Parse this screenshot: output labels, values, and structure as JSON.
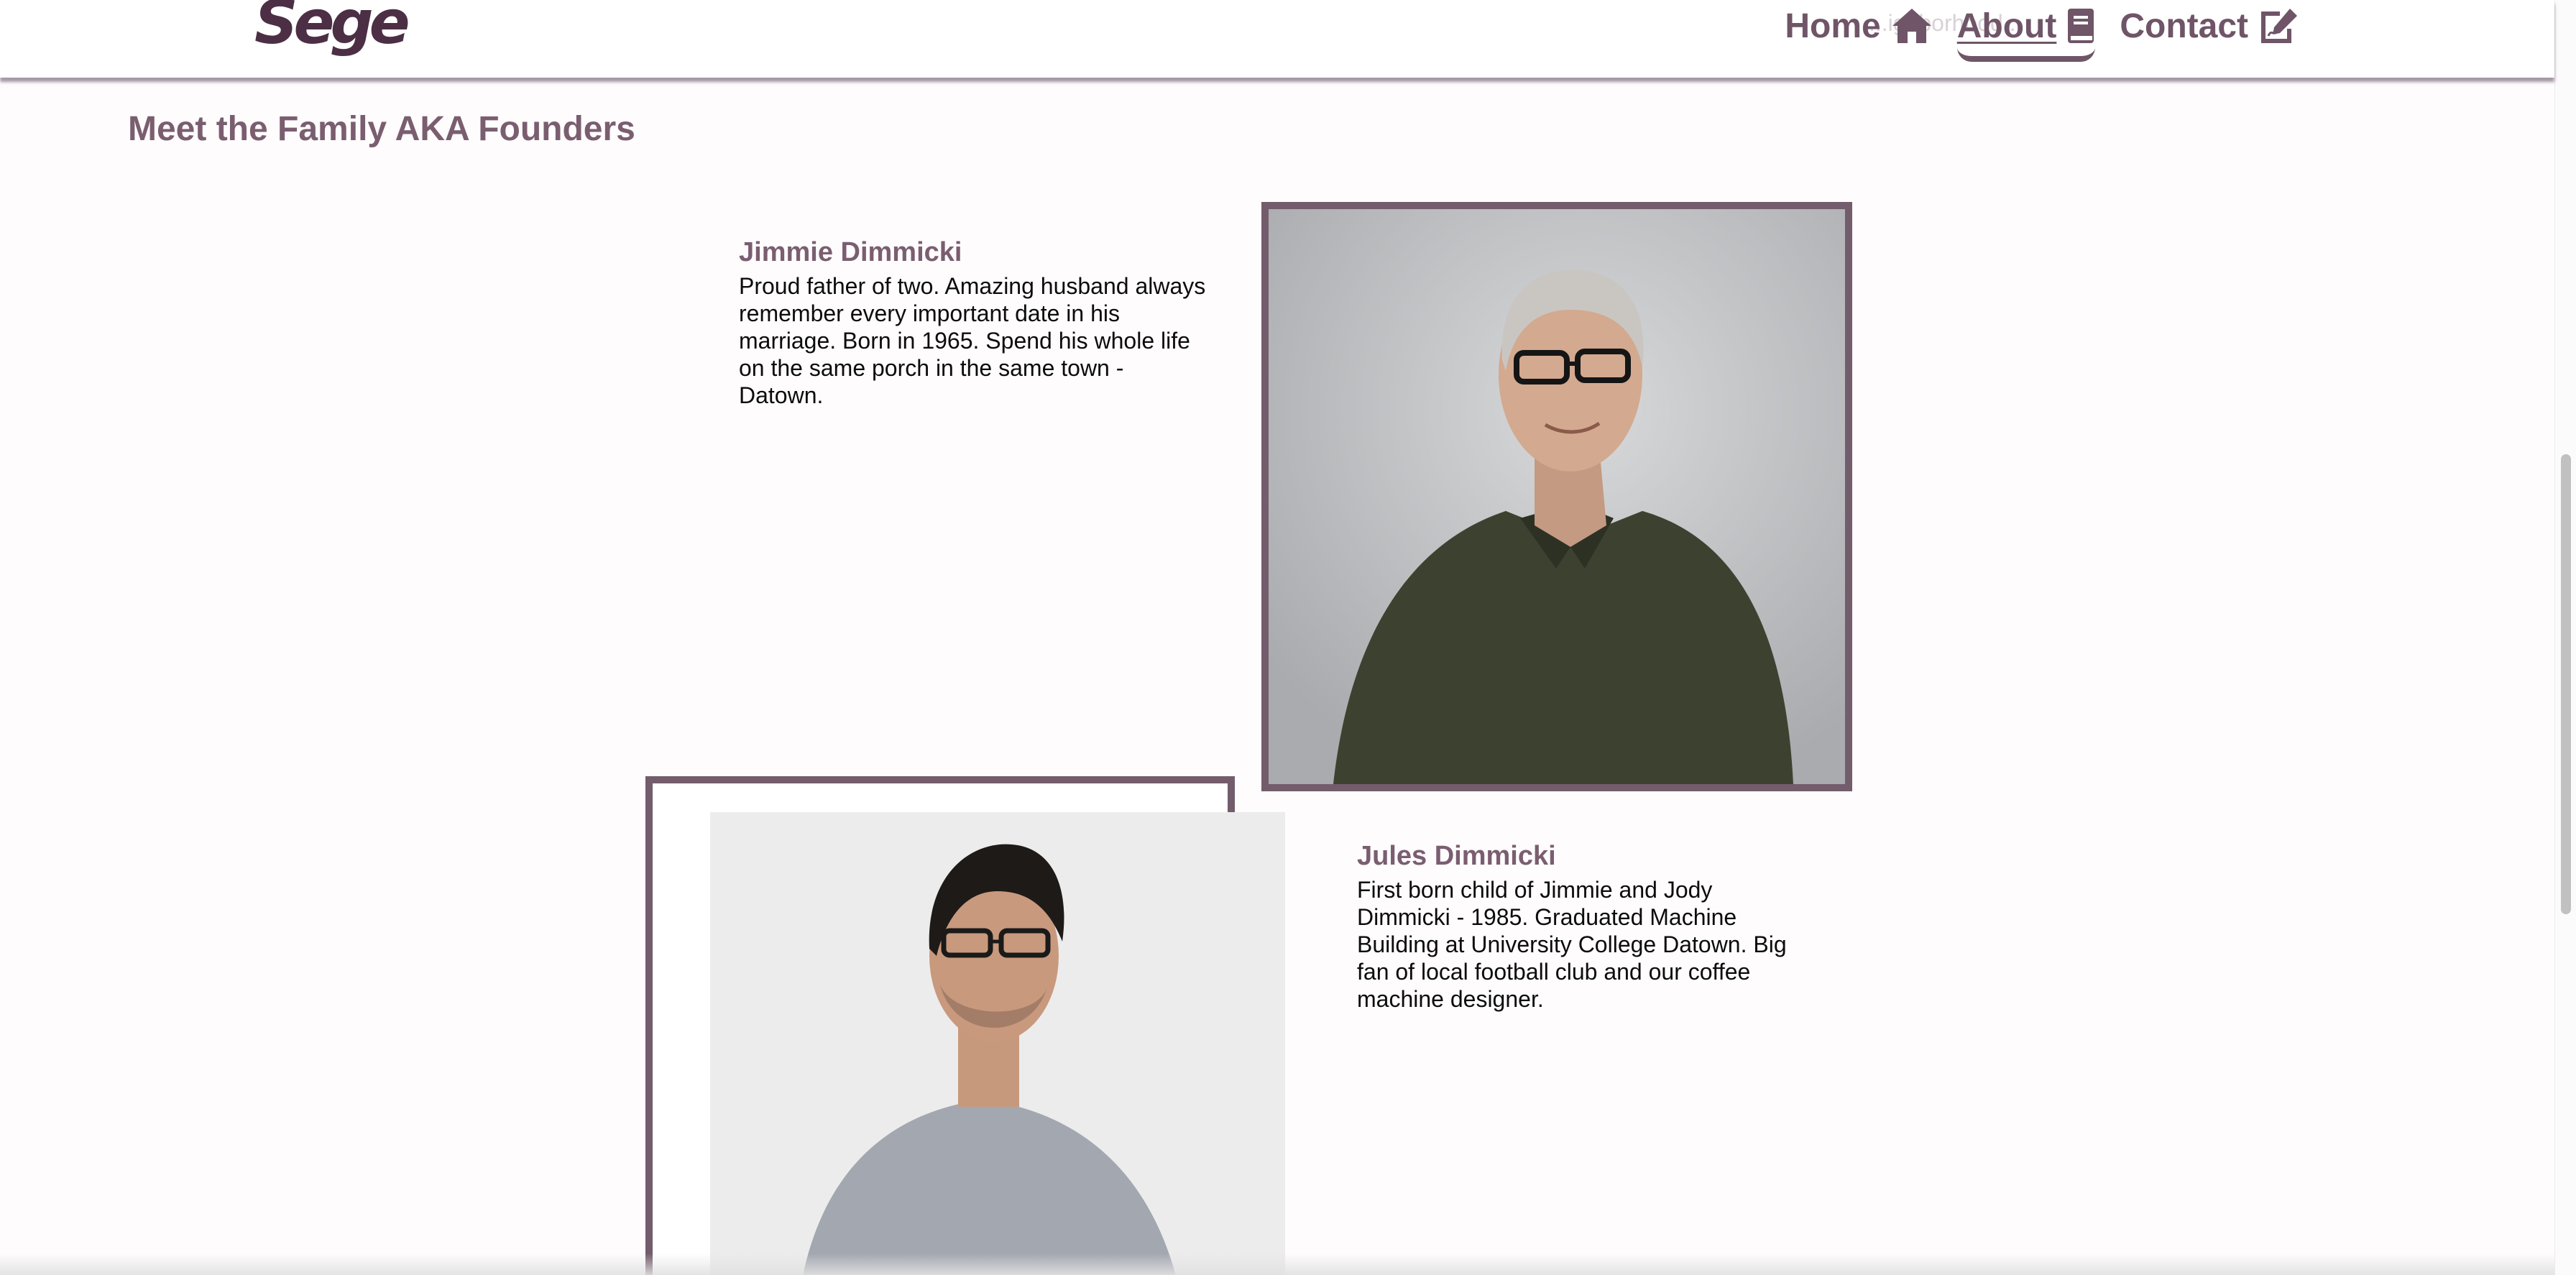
{
  "header": {
    "logo": "Sege",
    "faded_text": "...ighborhood...",
    "nav": [
      {
        "label": "Home",
        "icon": "home-icon",
        "active": false
      },
      {
        "label": "About",
        "icon": "book-icon",
        "active": true
      },
      {
        "label": "Contact",
        "icon": "edit-document-icon",
        "active": false
      }
    ]
  },
  "section": {
    "title": "Meet the Family AKA Founders",
    "people": [
      {
        "name": "Jimmie Dimmicki",
        "bio": "Proud father of two. Amazing husband always remember every important date in his marriage. Born in 1965. Spend his whole life on the same porch in the same town - Datown.",
        "photo": "portrait-older-man-green-polo"
      },
      {
        "name": "Jules Dimmicki",
        "bio": "First born child of Jimmie and Jody Dimmicki - 1985. Graduated Machine Building at University College Datown. Big fan of local football club and our coffee machine designer.",
        "photo": "portrait-man-grey-tshirt-arms-crossed"
      }
    ]
  },
  "colors": {
    "accent": "#735c6c",
    "logo": "#4c2f45",
    "heading": "#7a5e70",
    "text": "#0c0c0c"
  }
}
